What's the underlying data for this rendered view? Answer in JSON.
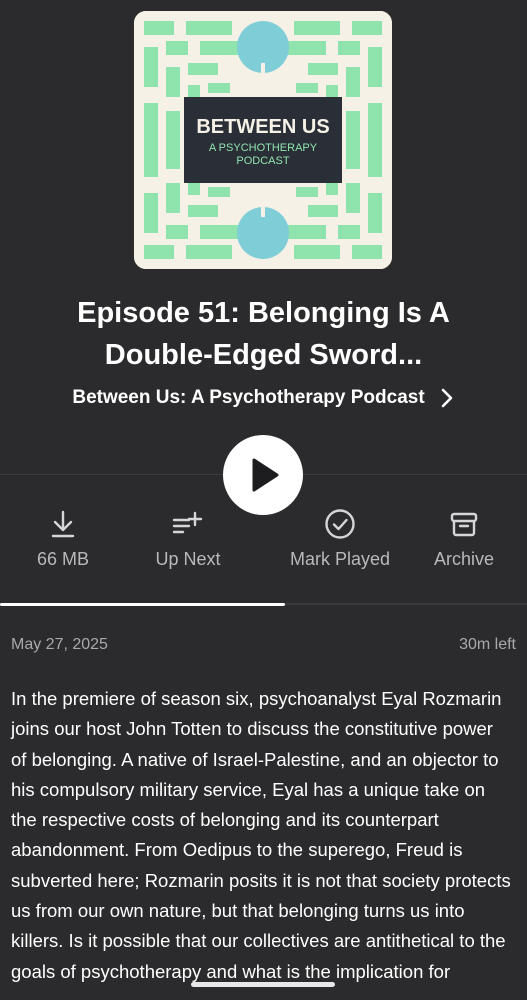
{
  "artwork": {
    "title_line1": "BETWEEN US",
    "title_line2": "A PSYCHOTHERAPY",
    "title_line3": "PODCAST",
    "colors": {
      "background": "#f6f1e6",
      "pattern": "#8fe3ad",
      "circle": "#7fcdd6",
      "panel": "#2a2f37"
    }
  },
  "episode": {
    "title": "Episode 51: Belonging Is A Double-Edged Sword...",
    "podcast_name": "Between Us: A Psychotherapy Podcast"
  },
  "actions": [
    {
      "icon": "download-icon",
      "label": "66 MB"
    },
    {
      "icon": "up-next-icon",
      "label": "Up Next"
    },
    {
      "icon": "check-circle-icon",
      "label": "Mark Played"
    },
    {
      "icon": "archive-icon",
      "label": "Archive"
    }
  ],
  "progress": {
    "fraction": 0.54
  },
  "meta": {
    "date": "May 27, 2025",
    "time_left": "30m left"
  },
  "description": "In the premiere of season six, psychoanalyst Eyal Rozmarin joins our host John Totten to discuss the constitutive power of belonging. A native of Israel-Palestine, and an objector to his compulsory military service, Eyal has a unique take on the respective costs of belonging and its counterpart abandonment. From Oedipus to the superego, Freud is subverted here; Rozmarin posits it is not that society protects us from our own nature, but that belonging turns us into killers. Is it possible that our collectives are antithetical to the goals of psychotherapy and what is the implication for",
  "colors": {
    "background": "#2b2b2d",
    "text": "#ffffff",
    "muted": "#b9b9bd"
  }
}
